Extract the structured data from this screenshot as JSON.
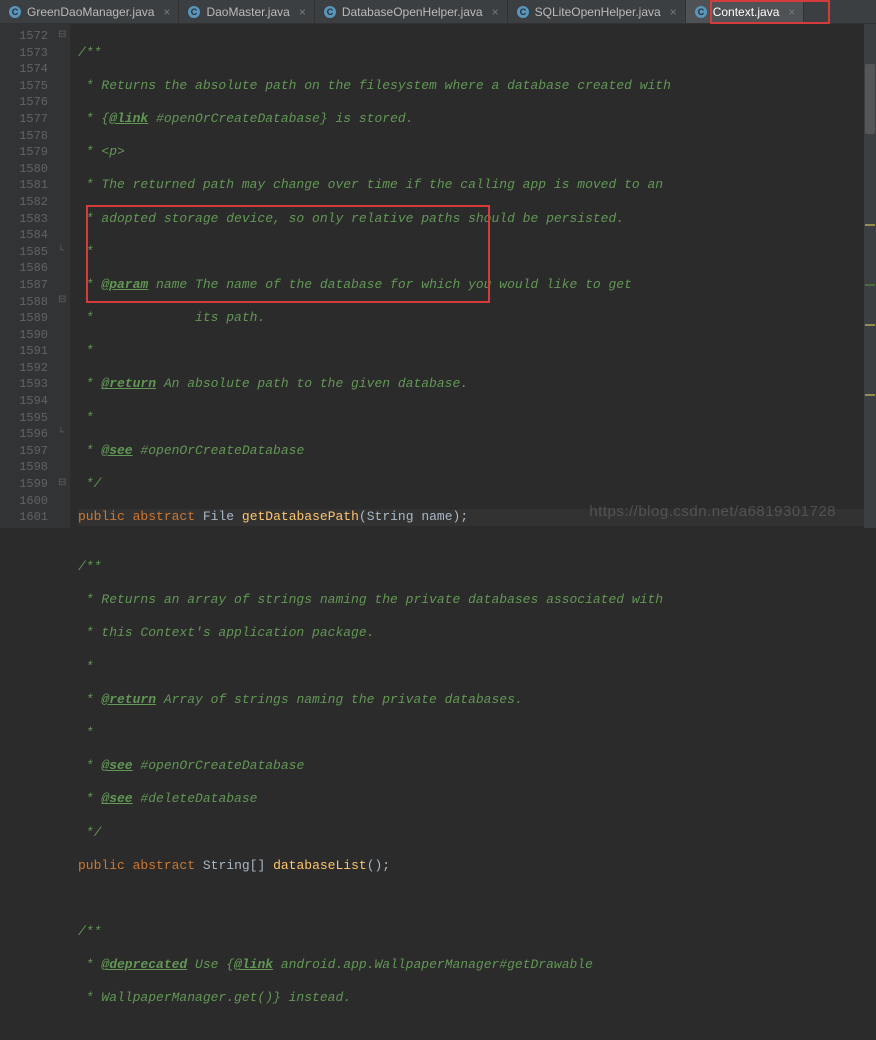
{
  "tabs": [
    {
      "label": "GreenDaoManager.java",
      "active": false
    },
    {
      "label": "DaoMaster.java",
      "active": false
    },
    {
      "label": "DatabaseOpenHelper.java",
      "active": false
    },
    {
      "label": "SQLiteOpenHelper.java",
      "active": false
    },
    {
      "label": "Context.java",
      "active": true
    }
  ],
  "gutter_start": 1572,
  "gutter_end": 1601,
  "code": {
    "l1572": "/**",
    "l1573a": " * Returns the absolute path on the filesystem where a database created with",
    "l1574a": " * {",
    "l1574b": "@link",
    "l1574c": " #openOrCreateDatabase} is stored.",
    "l1575": " * <p>",
    "l1576": " * The returned path may change over time if the calling app is moved to an",
    "l1577": " * adopted storage device, so only relative paths should be persisted.",
    "l1578": " *",
    "l1579a": " * ",
    "l1579b": "@param",
    "l1579c": " name The name of the database for which you would like to get",
    "l1580": " *             its path.",
    "l1581": " *",
    "l1582a": " * ",
    "l1582b": "@return",
    "l1582c": " An absolute path to the given database.",
    "l1583": " *",
    "l1584a": " * ",
    "l1584b": "@see",
    "l1584c": " #openOrCreateDatabase",
    "l1585": " */",
    "l1586kw1": "public",
    "l1586sp1": " ",
    "l1586kw2": "abstract",
    "l1586sp2": " ",
    "l1586ty": "File",
    "l1586sp3": " ",
    "l1586m": "getDatabasePath",
    "l1586p": "(String name);",
    "l1587": "",
    "l1588": "/**",
    "l1589": " * Returns an array of strings naming the private databases associated with",
    "l1590": " * this Context's application package.",
    "l1591": " *",
    "l1592a": " * ",
    "l1592b": "@return",
    "l1592c": " Array of strings naming the private databases.",
    "l1593": " *",
    "l1594a": " * ",
    "l1594b": "@see",
    "l1594c": " #openOrCreateDatabase",
    "l1595a": " * ",
    "l1595b": "@see",
    "l1595c": " #deleteDatabase",
    "l1596": " */",
    "l1597kw1": "public",
    "l1597sp1": " ",
    "l1597kw2": "abstract",
    "l1597sp2": " ",
    "l1597ty": "String",
    "l1597br": "[] ",
    "l1597m": "databaseList",
    "l1597p": "();",
    "l1598": "",
    "l1599": "/**",
    "l1600a": " * ",
    "l1600b": "@deprecated",
    "l1600c": " Use {",
    "l1600d": "@link",
    "l1600e": " android.app.WallpaperManager#getDrawable",
    "l1601": " * WallpaperManager.get()} instead."
  },
  "watermark": "https://blog.csdn.net/a6819301728"
}
